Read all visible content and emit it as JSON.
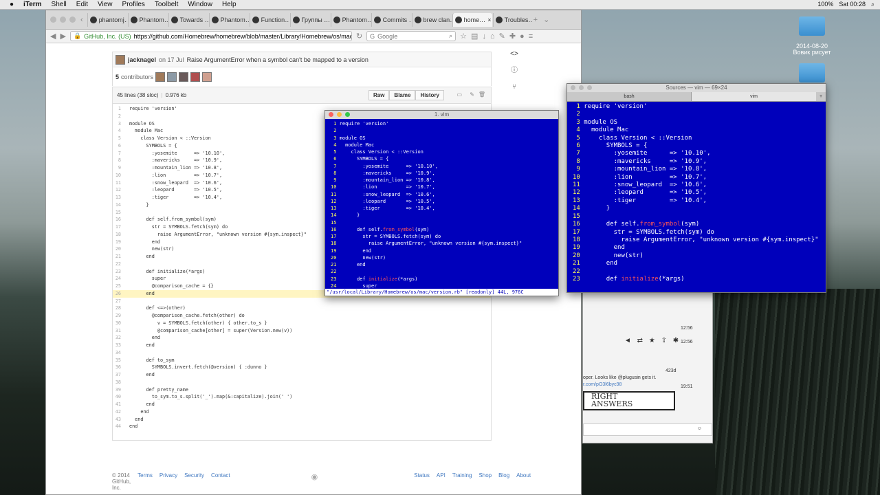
{
  "menubar": {
    "apple": "",
    "app": "iTerm",
    "items": [
      "Shell",
      "Edit",
      "View",
      "Profiles",
      "Toolbelt",
      "Window",
      "Help"
    ],
    "battery": "100%",
    "clock": "Sat 00:28"
  },
  "desktop": {
    "label1": "2014-08-20",
    "label2": "Вовик рисует"
  },
  "browser": {
    "tabs": [
      "phantomj…",
      "Phantom…",
      "Towards …",
      "Phantom…",
      "Function…",
      "Группы …",
      "Phantom…",
      "Commits …",
      "brew clan…",
      "home…",
      "Troubles…"
    ],
    "ev_label": "GitHub, Inc. (US)",
    "url": "https://github.com/Homebrew/homebrew/blob/master/Library/Homebrew/os/mac/version.rb#L26",
    "search_placeholder": "Google"
  },
  "commit": {
    "author": "jacknagel",
    "date": "on 17 Jul",
    "message": "Raise ArgumentError when a symbol can't be mapped to a version",
    "contributors_count": "5",
    "contributors_label": "contributors"
  },
  "file": {
    "lines": "45 lines (38 sloc)",
    "size": "0.976 kb",
    "raw": "Raw",
    "blame": "Blame",
    "history": "History"
  },
  "code": [
    "require 'version'",
    "",
    "module OS",
    "  module Mac",
    "    class Version < ::Version",
    "      SYMBOLS = {",
    "        :yosemite      => '10.10',",
    "        :mavericks     => '10.9',",
    "        :mountain_lion => '10.8',",
    "        :lion          => '10.7',",
    "        :snow_leopard  => '10.6',",
    "        :leopard       => '10.5',",
    "        :tiger         => '10.4',",
    "      }",
    "",
    "      def self.from_symbol(sym)",
    "        str = SYMBOLS.fetch(sym) do",
    "          raise ArgumentError, \"unknown version #{sym.inspect}\"",
    "        end",
    "        new(str)",
    "      end",
    "",
    "      def initialize(*args)",
    "        super",
    "        @comparison_cache = {}",
    "      end",
    "",
    "      def <=>(other)",
    "        @comparison_cache.fetch(other) do",
    "          v = SYMBOLS.fetch(other) { other.to_s }",
    "          @comparison_cache[other] = super(Version.new(v))",
    "        end",
    "      end",
    "",
    "      def to_sym",
    "        SYMBOLS.invert.fetch(@version) { :dunno }",
    "      end",
    "",
    "      def pretty_name",
    "        to_sym.to_s.split('_').map(&:capitalize).join(' ')",
    "      end",
    "    end",
    "  end",
    "end"
  ],
  "code_numbers": [
    "1",
    "2",
    "3",
    "4",
    "5",
    "6",
    "7",
    "8",
    "9",
    "10",
    "11",
    "12",
    "13",
    "14",
    "15",
    "16",
    "17",
    "18",
    "19",
    "20",
    "21",
    "22",
    "23",
    "24",
    "25",
    "26",
    "27",
    "28",
    "29",
    "30",
    "31",
    "32",
    "33",
    "34",
    "35",
    "36",
    "37",
    "38",
    "39",
    "40",
    "41",
    "42",
    "43",
    "44"
  ],
  "footer": {
    "copyright": "© 2014 GitHub, Inc.",
    "links_left": [
      "Terms",
      "Privacy",
      "Security",
      "Contact"
    ],
    "links_right": [
      "Status",
      "API",
      "Training",
      "Shop",
      "Blog",
      "About"
    ]
  },
  "vim1": {
    "title": "1. vim",
    "status": "\"/usr/local/Library/Homebrew/os/mac/version.rb\" [readonly] 44L, 976C"
  },
  "vim2": {
    "title": "Sources — vim — 69×24",
    "tab1": "bash",
    "tab2": "vim"
  },
  "chat": {
    "times": [
      "12:56",
      "12:56",
      "19:51"
    ],
    "count": "423d",
    "msg1": "oper. Looks like @plugusin gets it.",
    "msg2": "r.com/pO3l6byc98",
    "img_text1": "RIGHT",
    "img_text2": "ANSWERS"
  },
  "colors": {
    "vim_bg": "#0000bb",
    "highlight": "#fff5c2",
    "link": "#4078c0"
  }
}
